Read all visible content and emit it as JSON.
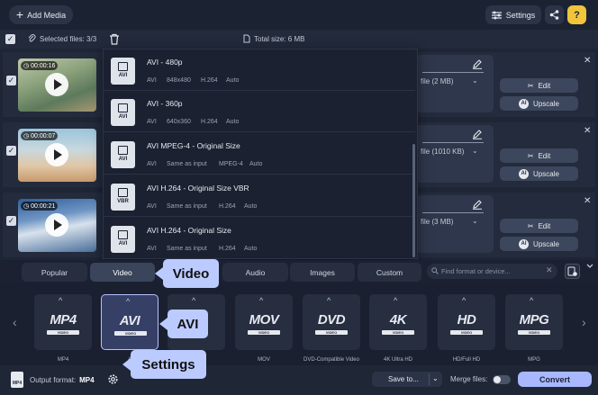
{
  "toolbar": {
    "add_media": "Add Media",
    "settings": "Settings",
    "help": "?"
  },
  "selection": {
    "selected_files": "Selected files: 3/3",
    "total_size": "Total size: 6 MB"
  },
  "files": [
    {
      "duration": "00:00:16",
      "out_size": "file (2 MB)",
      "edit": "Edit",
      "upscale": "Upscale"
    },
    {
      "duration": "00:00:07",
      "out_size": "file (1010 KB)",
      "edit": "Edit",
      "upscale": "Upscale"
    },
    {
      "duration": "00:00:21",
      "out_size": "file (3 MB)",
      "edit": "Edit",
      "upscale": "Upscale"
    }
  ],
  "presets": [
    {
      "name": "AVI - 480p",
      "container": "AVI",
      "resolution": "848x480",
      "codec": "H.264",
      "bitrate": "Auto",
      "icon_sub": "AVI"
    },
    {
      "name": "AVI - 360p",
      "container": "AVI",
      "resolution": "640x360",
      "codec": "H.264",
      "bitrate": "Auto",
      "icon_sub": "AVI"
    },
    {
      "name": "AVI MPEG-4 - Original Size",
      "container": "AVI",
      "resolution": "Same as input",
      "codec": "MPEG-4",
      "bitrate": "Auto",
      "icon_sub": "AVI"
    },
    {
      "name": "AVI H.264 - Original Size VBR",
      "container": "AVI",
      "resolution": "Same as input",
      "codec": "H.264",
      "bitrate": "Auto",
      "icon_sub": "VBR"
    },
    {
      "name": "AVI H.264 - Original Size",
      "container": "AVI",
      "resolution": "Same as input",
      "codec": "H.264",
      "bitrate": "Auto",
      "icon_sub": "AVI"
    }
  ],
  "tabs": [
    "Popular",
    "Video",
    "Audio",
    "Images",
    "Custom"
  ],
  "active_tab": "Video",
  "search": {
    "placeholder": "Find format or device..."
  },
  "formats": [
    {
      "logo": "MP4",
      "sub": "VIDEO",
      "label": "MP4"
    },
    {
      "logo": "AVI",
      "sub": "VIDEO",
      "label": "A"
    },
    {
      "logo": "",
      "sub": "",
      "label": ""
    },
    {
      "logo": "MOV",
      "sub": "VIDEO",
      "label": "MOV"
    },
    {
      "logo": "DVD",
      "sub": "VIDEO",
      "label": "DVD-Compatible Video"
    },
    {
      "logo": "4K",
      "sub": "VIDEO",
      "label": "4K Ultra HD"
    },
    {
      "logo": "HD",
      "sub": "VIDEO",
      "label": "HD/Full HD"
    },
    {
      "logo": "MPG",
      "sub": "VIDEO",
      "label": "MPG"
    }
  ],
  "bottom": {
    "output_label": "Output format:",
    "output_value": "MP4",
    "output_icon_text": "MP4",
    "save_to": "Save to...",
    "merge": "Merge files:",
    "merge_on": false,
    "convert": "Convert"
  },
  "callouts": {
    "video": "Video",
    "avi": "AVI",
    "settings": "Settings"
  },
  "colors": {
    "accent": "#a9b7ff",
    "callout": "#bccbff",
    "help": "#f0c53c",
    "background": "#1e2535"
  }
}
